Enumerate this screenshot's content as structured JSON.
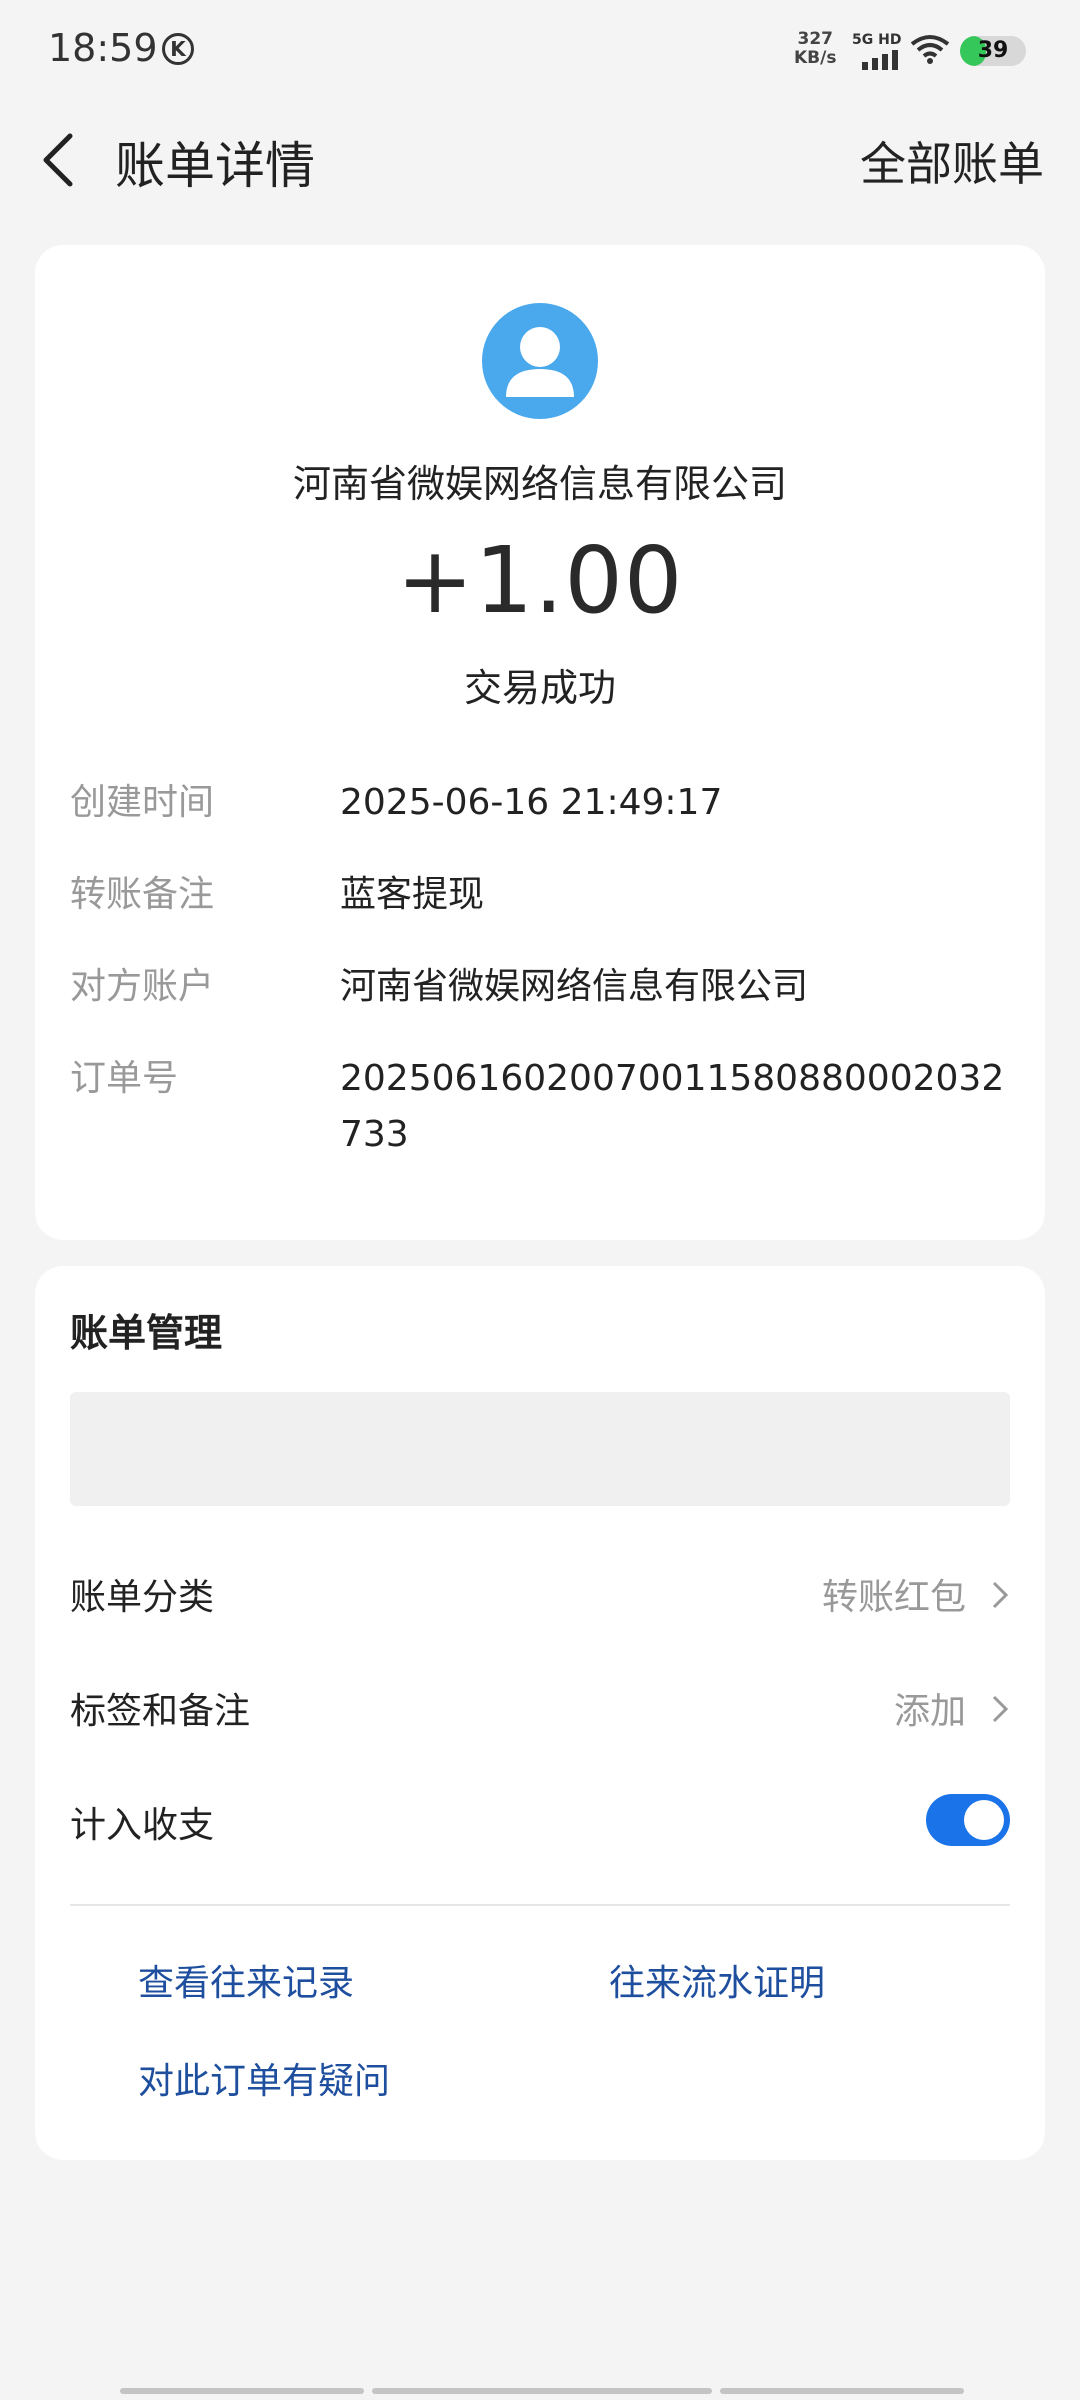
{
  "status_bar": {
    "time": "18:59",
    "k_badge": "K",
    "speed_value": "327",
    "speed_unit": "KB/s",
    "network": "5G HD",
    "battery": "39"
  },
  "header": {
    "title": "账单详情",
    "all_bills": "全部账单"
  },
  "transaction": {
    "payee": "河南省微娱网络信息有限公司",
    "amount": "+1.00",
    "status": "交易成功",
    "details": [
      {
        "label": "创建时间",
        "value": "2025-06-16 21:49:17"
      },
      {
        "label": "转账备注",
        "value": "蓝客提现"
      },
      {
        "label": "对方账户",
        "value": "河南省微娱网络信息有限公司"
      },
      {
        "label": "订单号",
        "value": "20250616020070011580880002032733"
      }
    ]
  },
  "management": {
    "title": "账单管理",
    "category_label": "账单分类",
    "category_value": "转账红包",
    "tags_label": "标签和备注",
    "tags_value": "添加",
    "include_label": "计入收支",
    "include_enabled": true,
    "links": {
      "history": "查看往来记录",
      "proof": "往来流水证明",
      "question": "对此订单有疑问"
    }
  },
  "colors": {
    "accent": "#1a73e8",
    "link": "#1e4e9e",
    "avatar": "#4aa8ec",
    "battery": "#35c759"
  }
}
